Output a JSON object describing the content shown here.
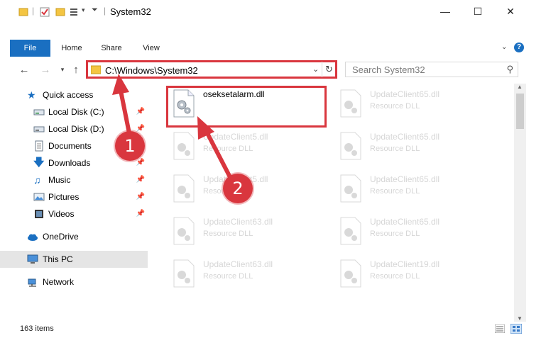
{
  "window": {
    "title": "System32",
    "minimize_icon": "minimize-icon",
    "maximize_icon": "maximize-icon",
    "close_icon": "close-icon"
  },
  "ribbon": {
    "tabs": [
      {
        "label": "File"
      },
      {
        "label": "Home"
      },
      {
        "label": "Share"
      },
      {
        "label": "View"
      }
    ],
    "help_icon": "?"
  },
  "address": {
    "path": "C:\\Windows\\System32",
    "search_placeholder": "Search System32"
  },
  "sidebar": {
    "items": [
      {
        "label": "Quick access",
        "icon": "star-icon"
      },
      {
        "label": "Local Disk (C:)",
        "icon": "drive-icon",
        "pinned": true
      },
      {
        "label": "Local Disk (D:)",
        "icon": "drive-icon",
        "pinned": true
      },
      {
        "label": "Documents",
        "icon": "document-icon",
        "pinned": true
      },
      {
        "label": "Downloads",
        "icon": "download-icon",
        "pinned": true
      },
      {
        "label": "Music",
        "icon": "music-icon",
        "pinned": true
      },
      {
        "label": "Pictures",
        "icon": "picture-icon",
        "pinned": true
      },
      {
        "label": "Videos",
        "icon": "video-icon",
        "pinned": true
      },
      {
        "label": "OneDrive",
        "icon": "cloud-icon"
      },
      {
        "label": "This PC",
        "icon": "computer-icon",
        "selected": true
      },
      {
        "label": "Network",
        "icon": "network-icon"
      }
    ]
  },
  "files": [
    {
      "name": "oseksetalarm.dll",
      "type": "",
      "highlighted": true
    },
    {
      "name": "UpdateClient65.dll",
      "type": "Resource DLL"
    },
    {
      "name": "UpdateClient5.dll",
      "type": "Resource DLL"
    },
    {
      "name": "UpdateClient65.dll",
      "type": "Resource DLL"
    },
    {
      "name": "UpdateClient5.dll",
      "type": "Resource DLL"
    },
    {
      "name": "UpdateClient65.dll",
      "type": "Resource DLL"
    },
    {
      "name": "UpdateClient63.dll",
      "type": "Resource DLL"
    },
    {
      "name": "UpdateClient65.dll",
      "type": "Resource DLL"
    },
    {
      "name": "UpdateClient63.dll",
      "type": "Resource DLL"
    },
    {
      "name": "UpdateClient19.dll",
      "type": "Resource DLL"
    }
  ],
  "status": {
    "item_count": "163 items"
  },
  "callouts": [
    {
      "number": "1"
    },
    {
      "number": "2"
    }
  ],
  "colors": {
    "accent": "#1a6fc1",
    "highlight_red": "#d9363e",
    "selected_bg": "#e5e5e5"
  }
}
